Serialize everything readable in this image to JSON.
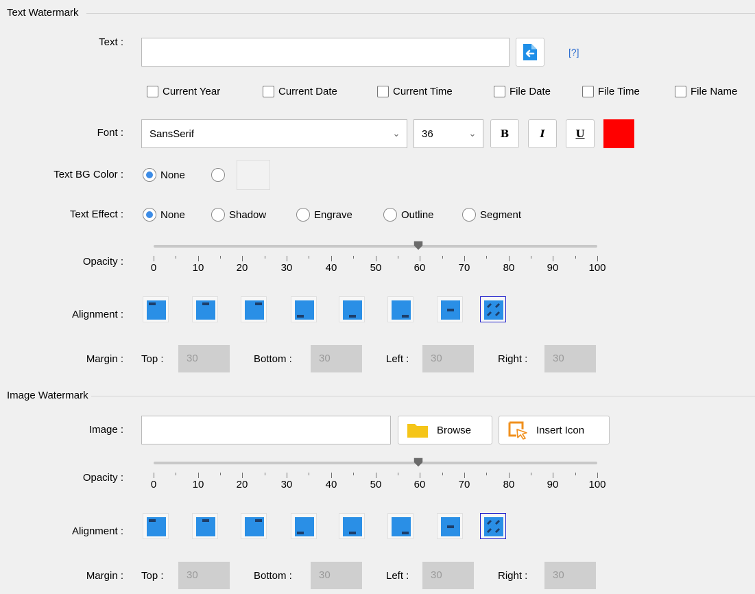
{
  "text_watermark": {
    "section_title": "Text Watermark",
    "text_label": "Text :",
    "text_value": "",
    "help_link": "[?]",
    "checkboxes": [
      {
        "label": "Current Year",
        "checked": false
      },
      {
        "label": "Current Date",
        "checked": false
      },
      {
        "label": "Current Time",
        "checked": false
      },
      {
        "label": "File Date",
        "checked": false
      },
      {
        "label": "File Time",
        "checked": false
      },
      {
        "label": "File Name",
        "checked": false
      }
    ],
    "font_label": "Font :",
    "font_family": "SansSerif",
    "font_size": "36",
    "bold_label": "B",
    "italic_label": "I",
    "underline_label": "U",
    "font_color": "#ff0000",
    "bg_color_label": "Text BG Color :",
    "bg_none_label": "None",
    "bg_selected": "None",
    "effect_label": "Text Effect :",
    "effects": [
      "None",
      "Shadow",
      "Engrave",
      "Outline",
      "Segment"
    ],
    "effect_selected": "None",
    "opacity_label": "Opacity :",
    "opacity_value": 60,
    "opacity_ticks": [
      "0",
      "10",
      "20",
      "30",
      "40",
      "50",
      "60",
      "70",
      "80",
      "90",
      "100"
    ],
    "alignment_label": "Alignment :",
    "alignment_selected": 7,
    "margin_label": "Margin :",
    "margin": {
      "top_label": "Top :",
      "top": "30",
      "bottom_label": "Bottom :",
      "bottom": "30",
      "left_label": "Left :",
      "left": "30",
      "right_label": "Right :",
      "right": "30"
    }
  },
  "image_watermark": {
    "section_title": "Image Watermark",
    "image_label": "Image :",
    "image_value": "",
    "browse_label": "Browse",
    "insert_icon_label": "Insert Icon",
    "opacity_label": "Opacity :",
    "opacity_value": 60,
    "opacity_ticks": [
      "0",
      "10",
      "20",
      "30",
      "40",
      "50",
      "60",
      "70",
      "80",
      "90",
      "100"
    ],
    "alignment_label": "Alignment :",
    "alignment_selected": 7,
    "margin_label": "Margin :",
    "margin": {
      "top_label": "Top :",
      "top": "30",
      "bottom_label": "Bottom :",
      "bottom": "30",
      "left_label": "Left :",
      "left": "30",
      "right_label": "Right :",
      "right": "30"
    }
  },
  "colors": {
    "accent": "#3c8ce6",
    "alignment_blue": "#2a8fe6",
    "selected_border": "#2222cc",
    "folder_yellow": "#f5c518",
    "insert_orange": "#f0901e"
  }
}
